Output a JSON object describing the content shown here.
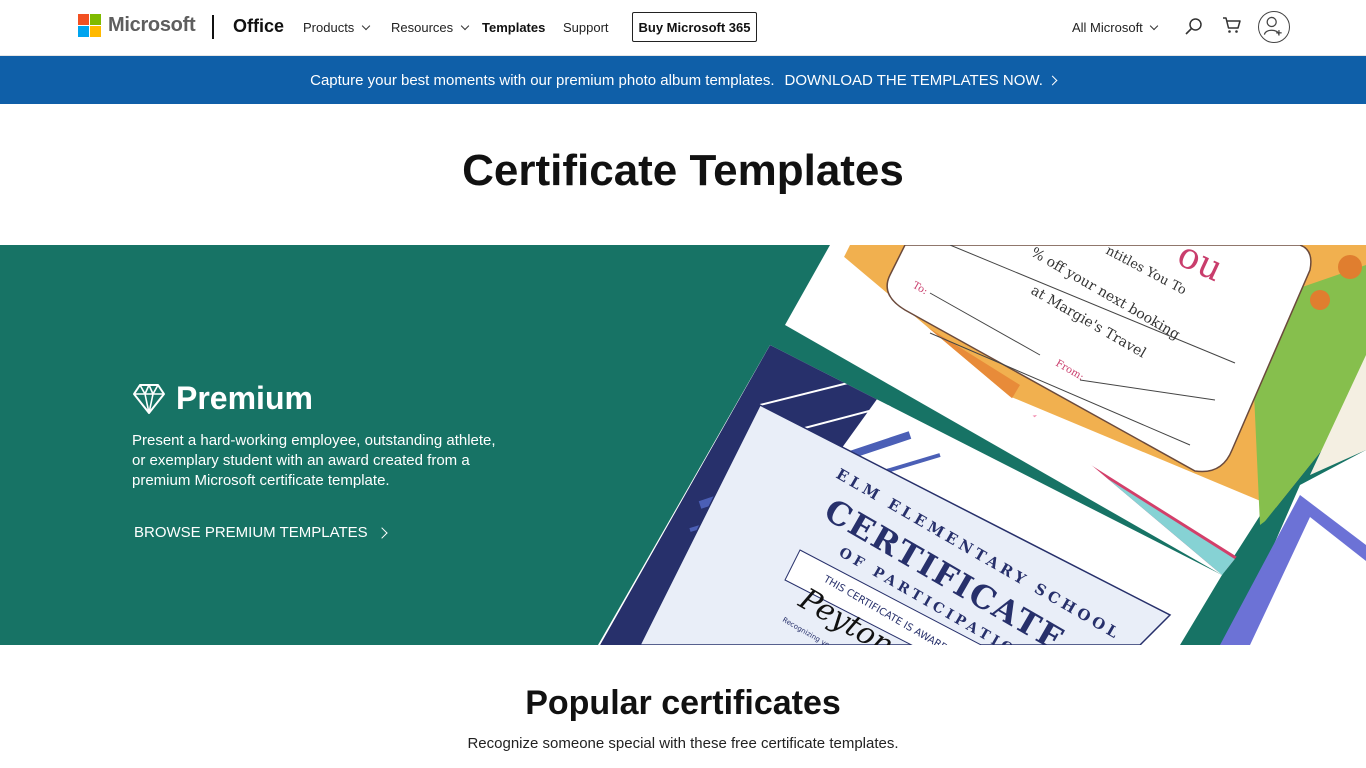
{
  "header": {
    "brand": "Microsoft",
    "product": "Office",
    "nav": [
      {
        "label": "Products",
        "dropdown": true
      },
      {
        "label": "Resources",
        "dropdown": true
      },
      {
        "label": "Templates",
        "dropdown": false
      },
      {
        "label": "Support",
        "dropdown": false
      }
    ],
    "buy_label": "Buy Microsoft 365",
    "all_microsoft": "All Microsoft",
    "icons": [
      "search-icon",
      "cart-icon",
      "account-icon"
    ],
    "logo_colors": [
      "#f25022",
      "#7fba00",
      "#00a4ef",
      "#ffb900"
    ]
  },
  "banner": {
    "text": "Capture your best moments with our premium photo album templates.",
    "cta": "DOWNLOAD THE TEMPLATES NOW.",
    "color": "#0f5fa8"
  },
  "page": {
    "title": "Certificate Templates"
  },
  "hero": {
    "icon": "diamond-icon",
    "heading": "Premium",
    "description": "Present a hard-working employee, outstanding athlete, or exemplary student with an award created from a premium Microsoft certificate template.",
    "cta": "BROWSE PREMIUM TEMPLATES",
    "background": "#177365",
    "gift_card": {
      "title_fragment": "ou",
      "line1": "% off your next booking",
      "line2": "at Margie's Travel",
      "entitles": "ntitles You To",
      "to_label": "To:",
      "from_label": "From:"
    },
    "certificate": {
      "school": "ELM ELEMENTARY SCHOOL",
      "title": "CERTIFICATE",
      "subtitle": "OF PARTICIPATION",
      "awarded": "THIS CERTIFICATE IS AWARDED",
      "name_fragment": "Peyton",
      "recognizing": "Recognizing your"
    }
  },
  "popular": {
    "title": "Popular certificates",
    "subtitle": "Recognize someone special with these free certificate templates."
  }
}
